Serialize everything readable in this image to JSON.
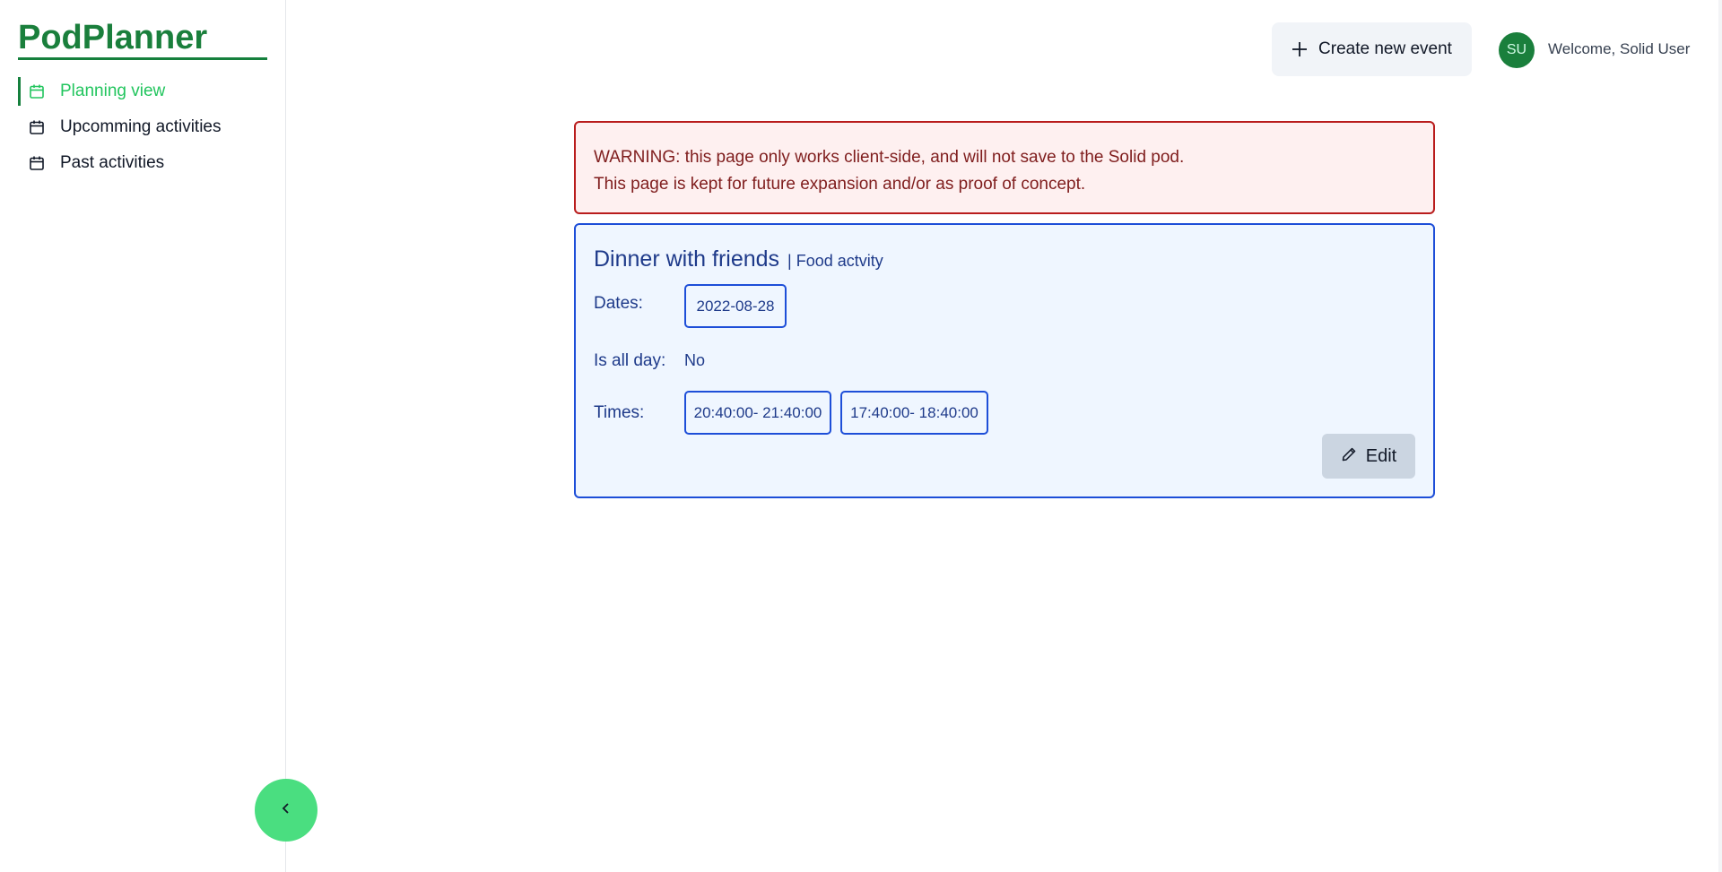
{
  "app": {
    "title": "PodPlanner"
  },
  "sidebar": {
    "items": [
      {
        "label": "Planning view",
        "icon": "calendar-icon",
        "active": true
      },
      {
        "label": "Upcomming activities",
        "icon": "calendar-icon",
        "active": false
      },
      {
        "label": "Past activities",
        "icon": "calendar-icon",
        "active": false
      }
    ],
    "collapse_icon": "chevron-left-icon"
  },
  "header": {
    "create_button_label": "Create new event",
    "create_button_icon": "plus-icon",
    "avatar_initials": "SU",
    "welcome_text": "Welcome, Solid User"
  },
  "warning": {
    "line1": "WARNING: this page only works client-side, and will not save to the Solid pod.",
    "line2": "This page is kept for future expansion and/or as proof of concept."
  },
  "event": {
    "title": "Dinner with friends",
    "type": "| Food actvity",
    "dates_label": "Dates:",
    "dates": [
      "2022-08-28"
    ],
    "all_day_label": "Is all day:",
    "all_day_value": "No",
    "times_label": "Times:",
    "times": [
      "20:40:00- 21:40:00",
      "17:40:00- 18:40:00"
    ],
    "edit_label": "Edit",
    "edit_icon": "pencil-icon"
  },
  "colors": {
    "brand_green": "#1a7f3c",
    "active_green": "#22c55e",
    "warning_border": "#b91c1c",
    "card_border": "#1d4ed8"
  }
}
